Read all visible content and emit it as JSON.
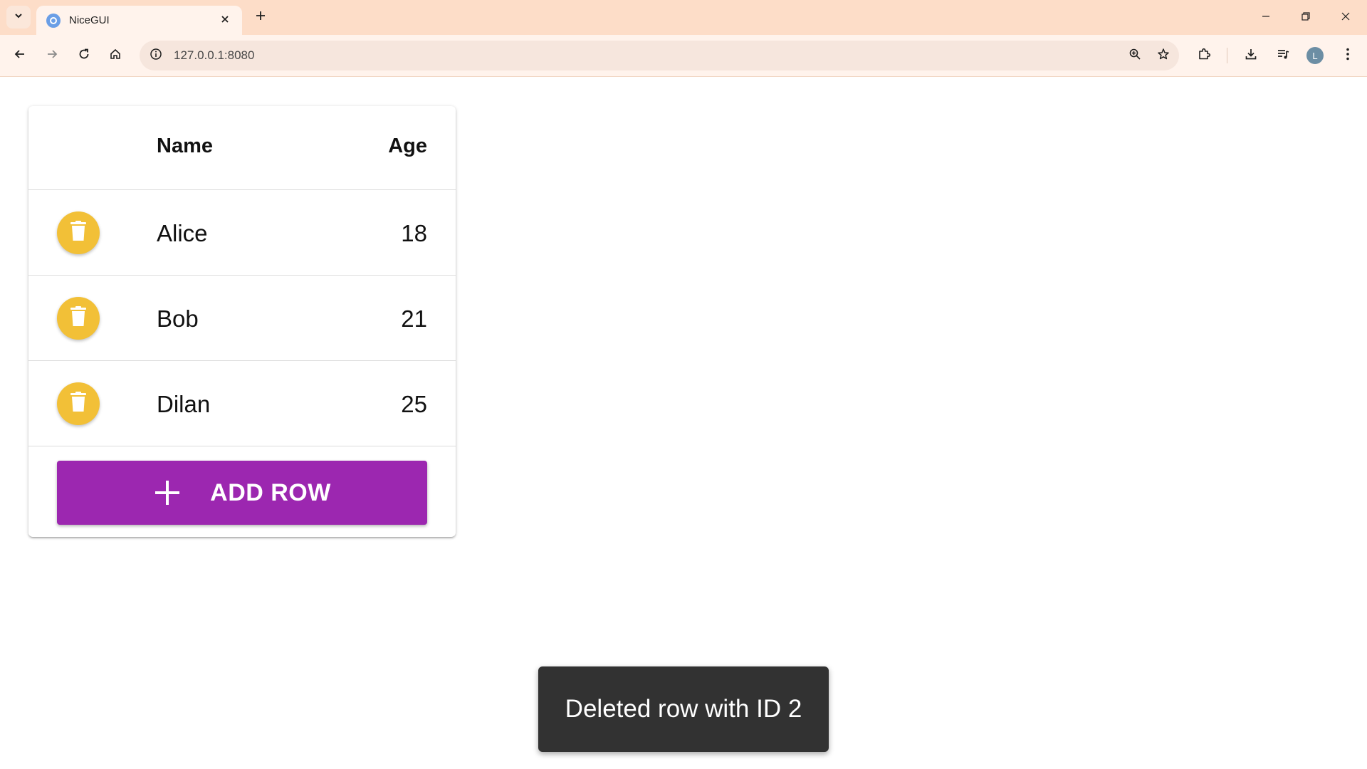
{
  "browser": {
    "tab_title": "NiceGUI",
    "url": "127.0.0.1:8080",
    "profile_initial": "L"
  },
  "table": {
    "columns": {
      "name": "Name",
      "age": "Age"
    },
    "rows": [
      {
        "name": "Alice",
        "age": "18"
      },
      {
        "name": "Bob",
        "age": "21"
      },
      {
        "name": "Dilan",
        "age": "25"
      }
    ],
    "add_button_label": "ADD ROW"
  },
  "notification": {
    "text": "Deleted row with ID 2"
  },
  "colors": {
    "delete_button": "#f2c037",
    "add_button": "#9c27b0",
    "toast_bg": "#323232",
    "tabbar_bg": "#fdddc8"
  },
  "icons": {
    "tab_search": "chevron-down-icon",
    "favicon": "nicegui-favicon-icon",
    "tab_close": "close-icon",
    "new_tab": "plus-icon",
    "back": "arrow-left-icon",
    "forward": "arrow-right-icon",
    "reload": "reload-icon",
    "home": "home-icon",
    "site_info": "info-icon",
    "zoom": "zoom-in-icon",
    "bookmark": "star-icon",
    "extensions": "puzzle-icon",
    "downloads": "download-icon",
    "media": "media-control-icon",
    "menu": "kebab-menu-icon",
    "delete": "trash-icon",
    "add": "plus-icon"
  }
}
